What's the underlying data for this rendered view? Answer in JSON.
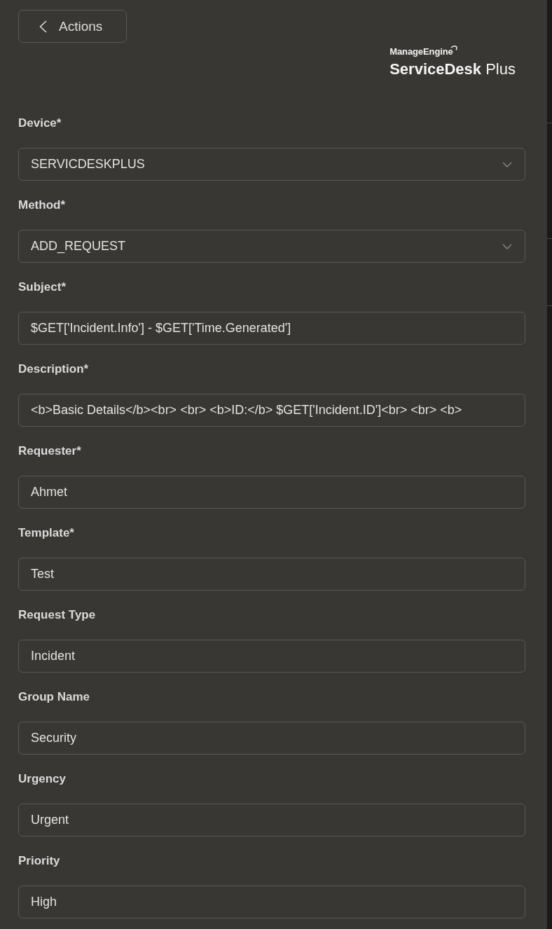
{
  "back_button": {
    "label": "Actions"
  },
  "logo": {
    "brand": "ManageEngine",
    "product": "**ServiceDesk** Plus"
  },
  "form": {
    "fields": [
      {
        "label": "Device*",
        "kind": "dropdown",
        "value": "SERVICDESKPLUS"
      },
      {
        "label": "Method*",
        "kind": "dropdown",
        "value": "ADD_REQUEST"
      },
      {
        "label": "Subject*",
        "kind": "text",
        "value": "$GET['Incident.Info'] - $GET['Time.Generated']"
      },
      {
        "label": "Description*",
        "kind": "text",
        "value": "<b>Basic Details</b><br> <br> <b>ID:</b> $GET['Incident.ID']<br> <br> <b>"
      },
      {
        "label": "Requester*",
        "kind": "text",
        "value": "Ahmet"
      },
      {
        "label": "Template*",
        "kind": "text",
        "value": "Test"
      },
      {
        "label": "Request Type",
        "kind": "text",
        "value": "Incident"
      },
      {
        "label": "Group Name",
        "kind": "text",
        "value": "Security"
      },
      {
        "label": "Urgency",
        "kind": "text",
        "value": "Urgent"
      },
      {
        "label": "Priority",
        "kind": "text",
        "value": "High"
      }
    ]
  }
}
